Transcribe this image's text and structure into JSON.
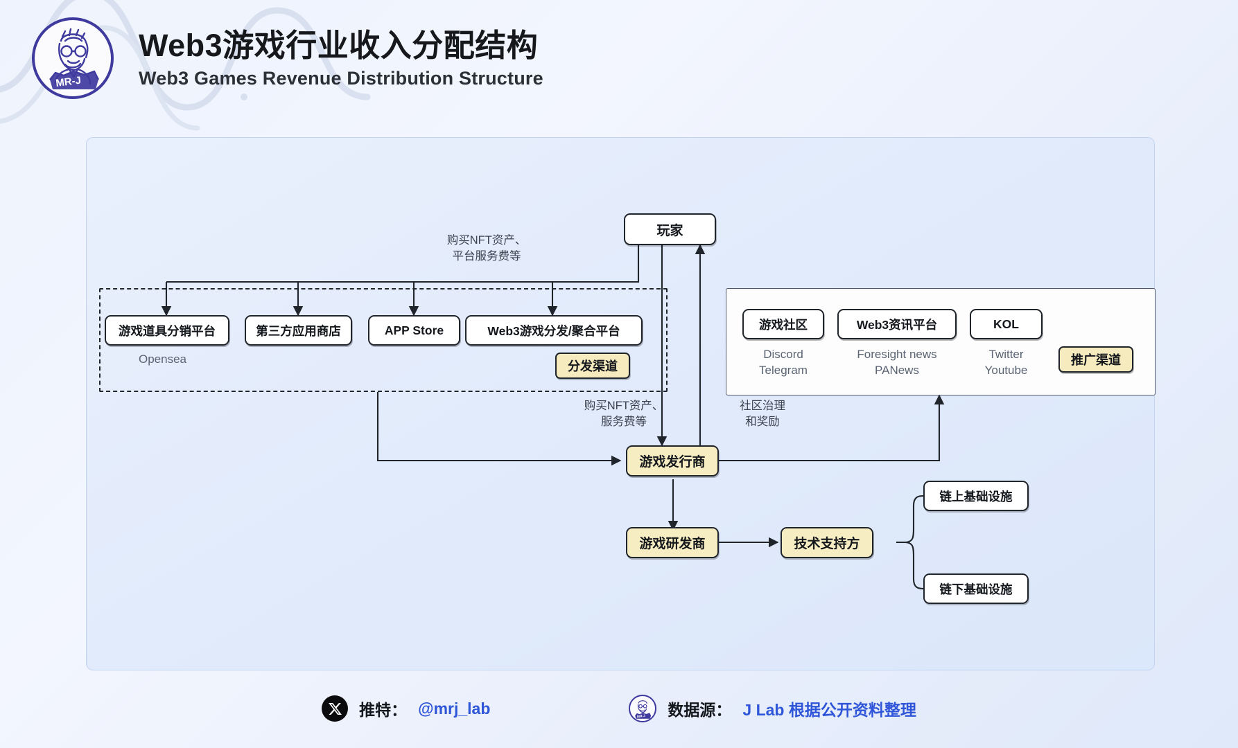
{
  "header": {
    "title_cn": "Web3游戏行业收入分配结构",
    "title_en": "Web3 Games  Revenue Distribution Structure",
    "logo_alt": "mr-j-logo"
  },
  "diagram": {
    "player_node": "玩家",
    "publisher_node": "游戏发行商",
    "developer_node": "游戏研发商",
    "tech_support_node": "技术支持方",
    "distribution_group": {
      "badge": "分发渠道",
      "nodes": [
        {
          "label": "游戏道具分销平台",
          "sub": "Opensea"
        },
        {
          "label": "第三方应用商店",
          "sub": ""
        },
        {
          "label": "APP Store",
          "sub": ""
        },
        {
          "label": "Web3游戏分发/聚合平台",
          "sub": ""
        }
      ]
    },
    "promotion_group": {
      "badge": "推广渠道",
      "nodes": [
        {
          "label": "游戏社区",
          "sub": "Discord\nTelegram"
        },
        {
          "label": "Web3资讯平台",
          "sub": "Foresight news\nPANews"
        },
        {
          "label": "KOL",
          "sub": "Twitter\nYoutube"
        }
      ]
    },
    "infrastructure": [
      "链上基础设施",
      "链下基础设施"
    ],
    "edge_labels": {
      "player_to_channels": "购买NFT资产、\n平台服务费等",
      "player_to_publisher": "购买NFT资产、\n服务费等",
      "publisher_to_promotion": "社区治理\n和奖励"
    }
  },
  "footer": {
    "twitter_label": "推特：",
    "twitter_handle": "@mrj_lab",
    "source_label": "数据源：",
    "source_value": "J Lab 根据公开资料整理"
  },
  "colors": {
    "accent_blue": "#2f56d8",
    "node_yellow": "#f7edc2",
    "outline": "#20242b",
    "panel_bg": "#e4edfb"
  }
}
